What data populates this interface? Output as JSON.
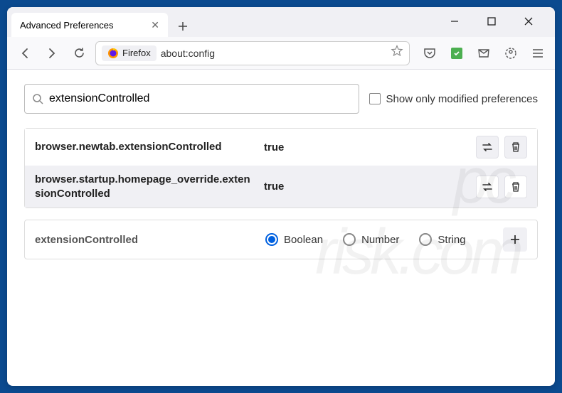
{
  "tab": {
    "title": "Advanced Preferences"
  },
  "toolbar": {
    "fx_label": "Firefox",
    "url": "about:config"
  },
  "search": {
    "value": "extensionControlled",
    "show_modified_label": "Show only modified preferences"
  },
  "prefs": [
    {
      "name": "browser.newtab.extensionControlled",
      "value": "true"
    },
    {
      "name": "browser.startup.homepage_override.extensionControlled",
      "value": "true"
    }
  ],
  "create": {
    "name": "extensionControlled",
    "types": [
      "Boolean",
      "Number",
      "String"
    ],
    "selected": "Boolean"
  },
  "watermark1": "pc",
  "watermark2": "risk.com"
}
